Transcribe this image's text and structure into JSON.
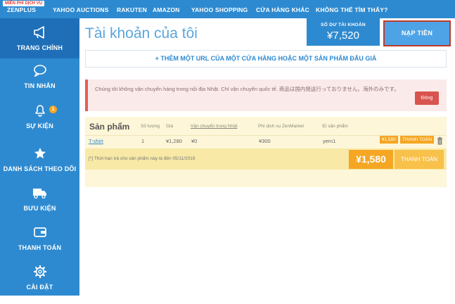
{
  "topnav": {
    "free_badge": "MIỄN PHÍ DỊCH VỤ",
    "items": [
      "ZENPLUS",
      "YAHOO AUCTIONS",
      "RAKUTEN",
      "AMAZON",
      "YAHOO SHOPPING",
      "CỬA HÀNG KHÁC",
      "KHÔNG THỂ TÌM THẤY?"
    ]
  },
  "sidebar": {
    "items": [
      {
        "label": "TRANG CHÍNH",
        "icon": "megaphone-icon"
      },
      {
        "label": "TIN NHẮN",
        "icon": "chat-bubble-icon"
      },
      {
        "label": "SỰ KIỆN",
        "icon": "bell-icon",
        "count": "1"
      },
      {
        "label": "DANH SÁCH THEO DÕI",
        "icon": "star-icon"
      },
      {
        "label": "BƯU KIỆN",
        "icon": "truck-icon"
      },
      {
        "label": "THANH TOÁN",
        "icon": "wallet-icon"
      },
      {
        "label": "CÀI ĐẶT",
        "icon": "gear-icon"
      }
    ]
  },
  "header": {
    "title": "Tài khoản của tôi",
    "balance_label": "SỐ DƯ TÀI KHOẢN",
    "balance_value": "¥7,520",
    "topup_label": "NẠP TIỀN"
  },
  "add_url_label": "+ THÊM MỘT URL CỦA MỘT CỬA HÀNG HOẶC MỘT SẢN PHẨM ĐẤU GIÁ",
  "notice": {
    "text": "Chúng tôi không vận chuyển hàng trong nội địa Nhật. Chỉ vận chuyển quốc tế. 商品は国内発送行っておりません。海外のみです。",
    "close_label": "Đóng"
  },
  "products": {
    "title": "Sản phẩm",
    "columns": [
      "Số lượng",
      "Giá",
      "Vận chuyển trong Nhật",
      "Phí dịch vụ ZenMarket",
      "ID sản phẩm"
    ],
    "row": {
      "name": "T-shirt",
      "qty": "1",
      "price": "¥1,280",
      "shipping": "¥0",
      "fee": "¥300",
      "id": "yem1",
      "mini_total": "¥1,580",
      "mini_pay": "THANH TOÁN"
    },
    "footer_note": "[*] Thời hạn trả cho sản phẩm này là đến 05/11/2019",
    "total": "¥1,580",
    "pay_label": "THANH TOÁN"
  },
  "colors": {
    "primary": "#2e8ad0",
    "accent": "#f5a623",
    "danger": "#d9534f"
  }
}
